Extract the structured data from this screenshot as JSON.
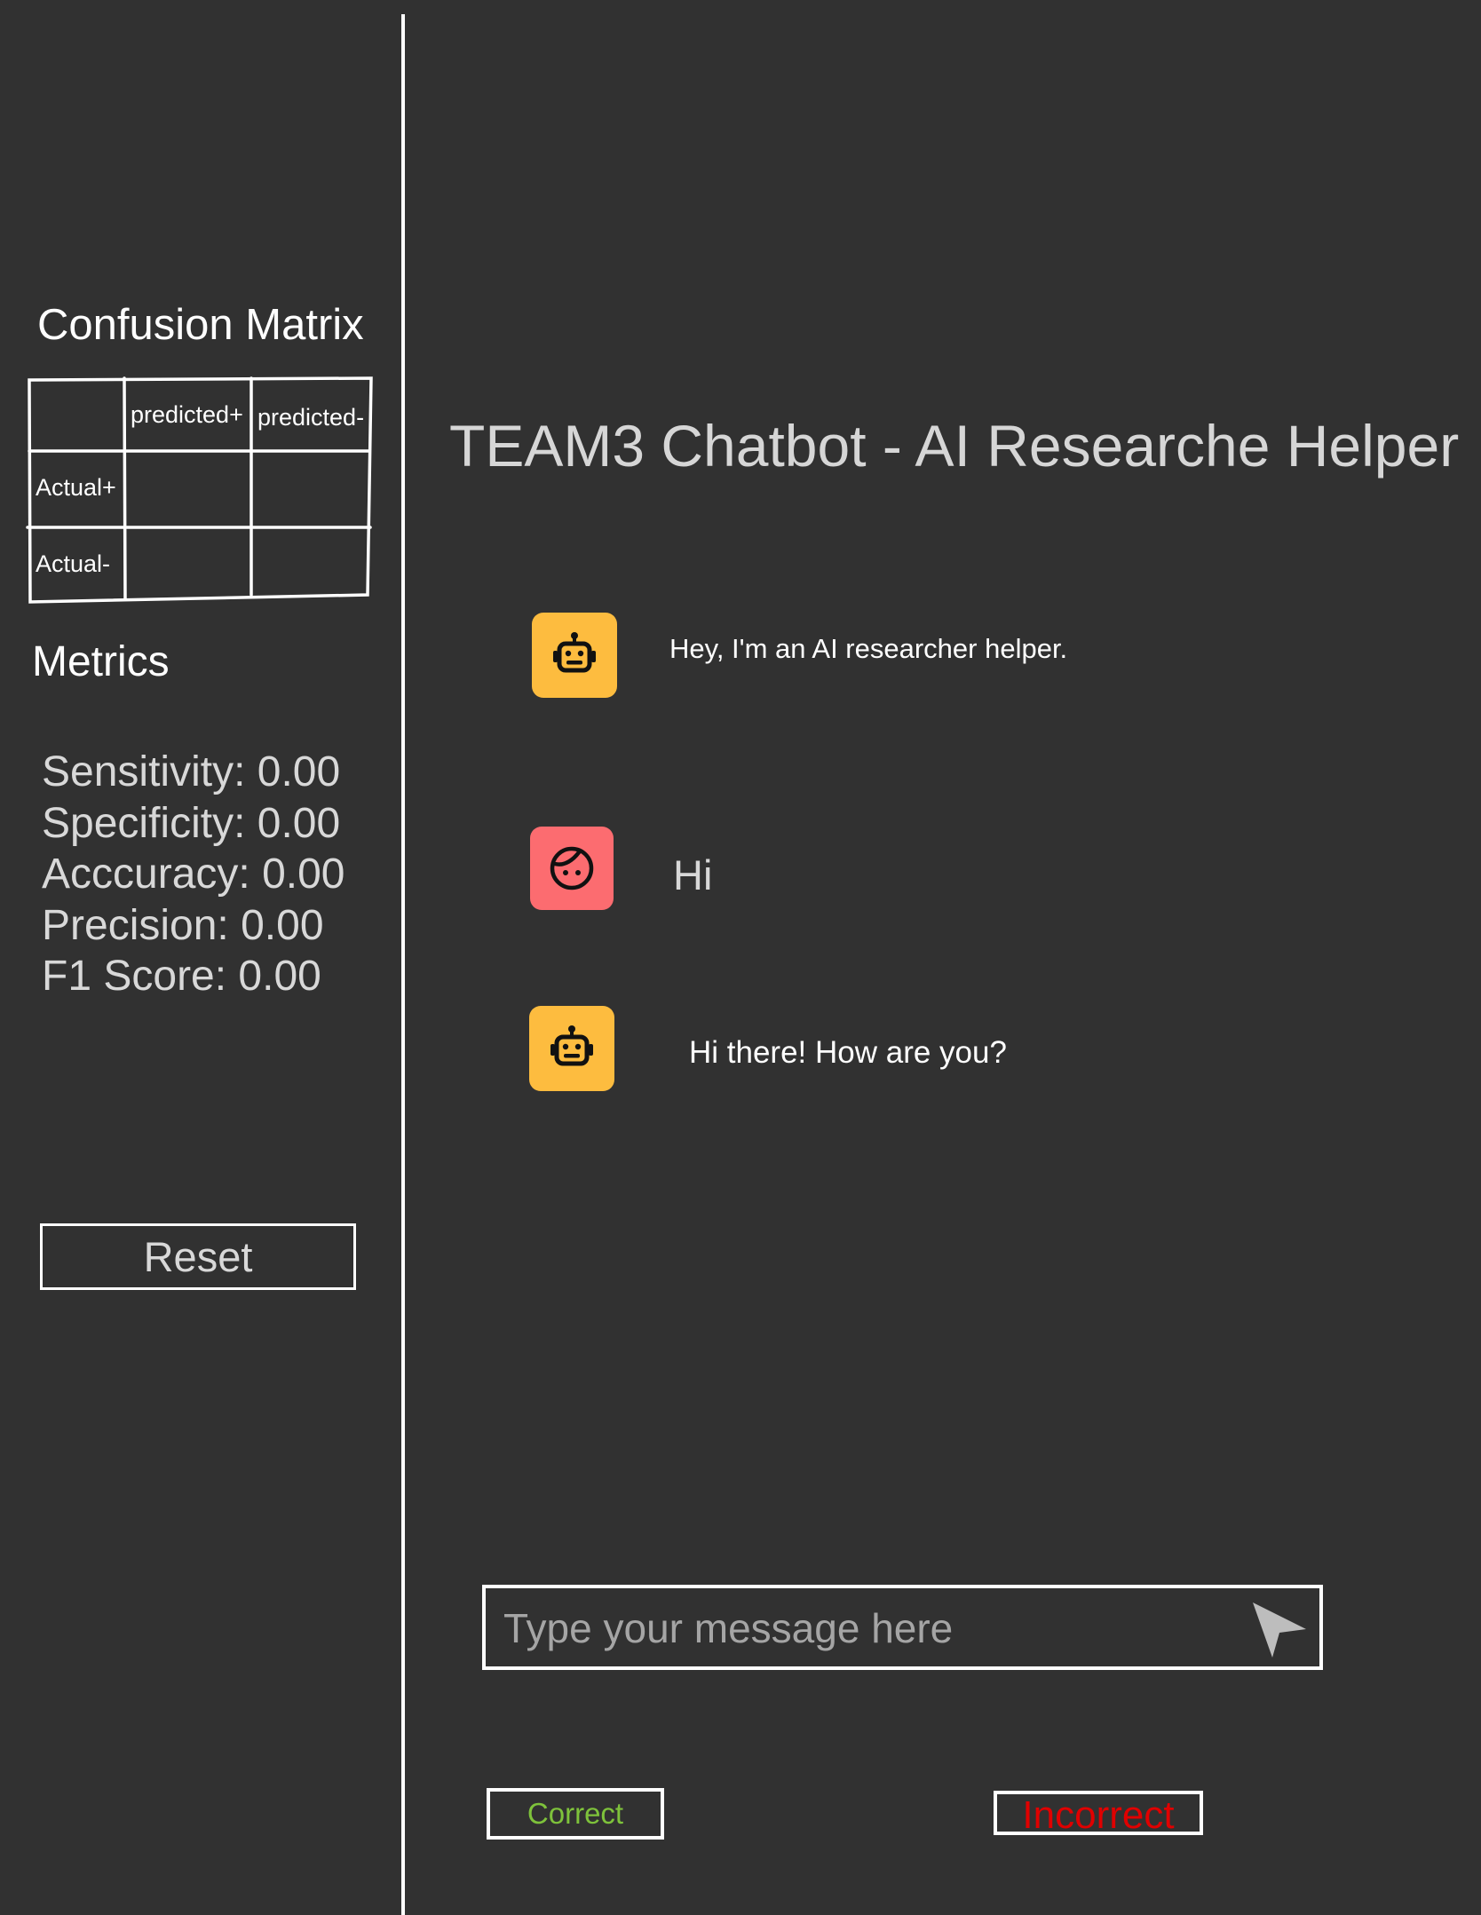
{
  "sidebar": {
    "confusion_matrix": {
      "title": "Confusion Matrix",
      "col_headers": [
        "predicted+",
        "predicted-"
      ],
      "row_headers": [
        "Actual+",
        "Actual-"
      ]
    },
    "metrics": {
      "title": "Metrics",
      "items": [
        "Sensitivity: 0.00",
        "Specificity: 0.00",
        "Acccuracy: 0.00",
        "Precision: 0.00",
        "F1 Score: 0.00"
      ]
    },
    "reset_label": "Reset"
  },
  "chat": {
    "title": "TEAM3 Chatbot - AI Researche Helper",
    "messages": [
      {
        "sender": "bot",
        "icon": "robot-icon",
        "text": "Hey, I'm an AI researcher helper."
      },
      {
        "sender": "user",
        "icon": "face-icon",
        "text": "Hi"
      },
      {
        "sender": "bot",
        "icon": "robot-icon",
        "text": "Hi there! How are you?"
      }
    ],
    "input": {
      "placeholder": "Type your message here",
      "value": "",
      "send_icon": "send-icon"
    },
    "feedback": {
      "correct_label": "Correct",
      "incorrect_label": "Incorrect"
    }
  },
  "colors": {
    "background": "#313131",
    "bot_avatar": "#fdbc3f",
    "user_avatar": "#fc6c70",
    "correct": "#7ec23b",
    "incorrect": "#e00000"
  }
}
